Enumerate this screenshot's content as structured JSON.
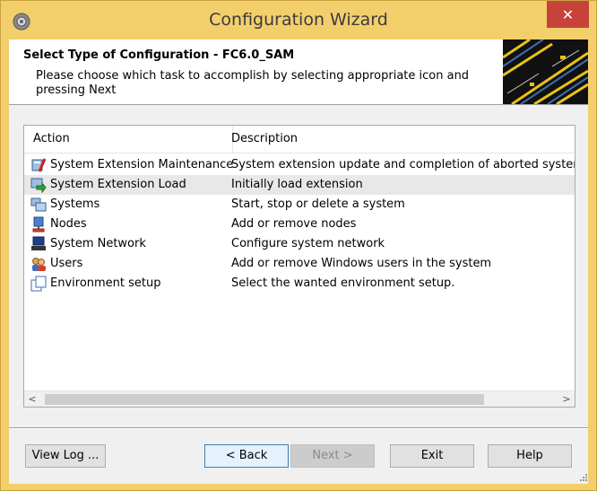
{
  "window": {
    "title": "Configuration Wizard",
    "close_label": "✕",
    "accent_color": "#f3cf6c",
    "close_color": "#c7423b"
  },
  "header": {
    "title": "Select Type of Configuration - FC6.0_SAM",
    "description": "Please choose which task to accomplish by selecting appropriate icon and pressing Next"
  },
  "list": {
    "columns": [
      "Action",
      "Description"
    ],
    "rows": [
      {
        "action": "System Extension Maintenance",
        "description": "System extension update and completion of aborted system e",
        "icon": "maintenance-icon",
        "selected": false
      },
      {
        "action": "System Extension Load",
        "description": "Initially load extension",
        "icon": "load-extension-icon",
        "selected": true
      },
      {
        "action": "Systems",
        "description": "Start, stop or delete a system",
        "icon": "systems-icon",
        "selected": false
      },
      {
        "action": "Nodes",
        "description": "Add or remove nodes",
        "icon": "nodes-icon",
        "selected": false
      },
      {
        "action": "System Network",
        "description": "Configure system network",
        "icon": "network-icon",
        "selected": false
      },
      {
        "action": "Users",
        "description": "Add or remove Windows users in the system",
        "icon": "users-icon",
        "selected": false
      },
      {
        "action": "Environment setup",
        "description": "Select the wanted environment setup.",
        "icon": "environment-icon",
        "selected": false
      }
    ],
    "scroll_left": "<",
    "scroll_right": ">"
  },
  "buttons": {
    "view_log": "View Log ...",
    "back": "< Back",
    "next": "Next >",
    "exit": "Exit",
    "help": "Help"
  }
}
